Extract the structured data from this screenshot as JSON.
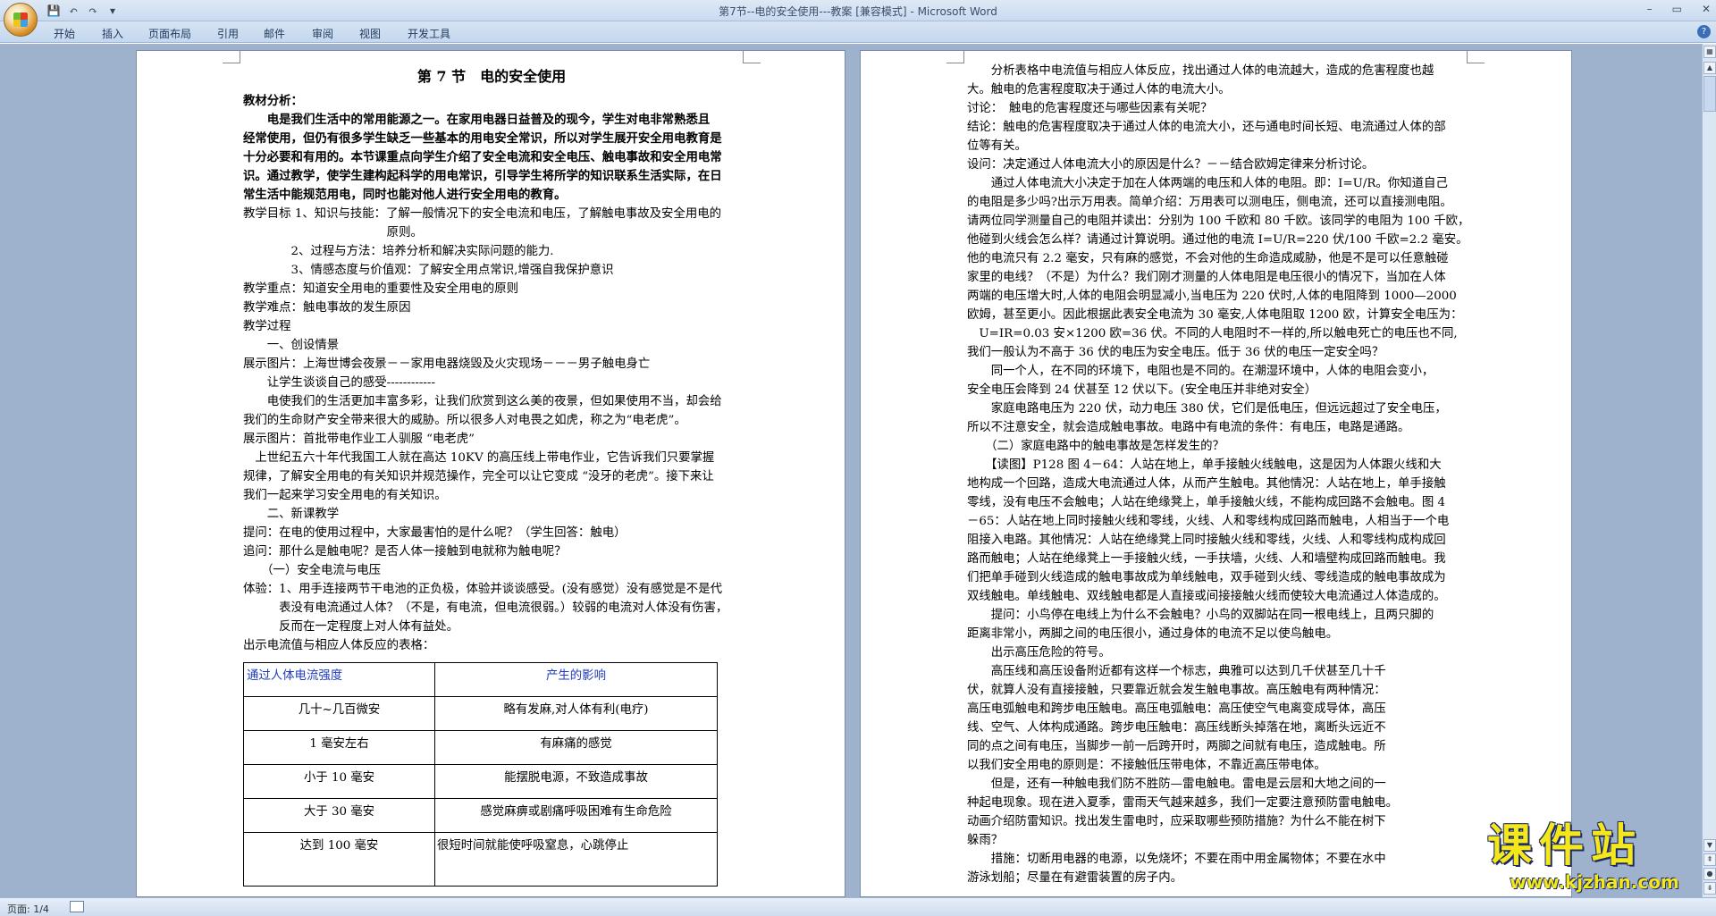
{
  "window": {
    "title": "第7节--电的安全使用---教案 [兼容模式] - Microsoft Word",
    "controls": [
      "–",
      "▭",
      "✕"
    ]
  },
  "ribbon": {
    "tabs": [
      "开始",
      "插入",
      "页面布局",
      "引用",
      "邮件",
      "审阅",
      "视图",
      "开发工具"
    ]
  },
  "status": {
    "page": "页面: 1/4"
  },
  "watermark": {
    "brand": "课件站",
    "url": "www.kjzhan.com"
  },
  "page1": {
    "lines": [
      "第 7 节　电的安全使用",
      "教材分析：",
      "　　电是我们生活中的常用能源之一。在家用电器日益普及的现今，学生对电非常熟悉且",
      "经常使用，但仍有很多学生缺乏一些基本的用电安全常识，所以对学生展开安全用电教育是",
      "十分必要和有用的。本节课重点向学生介绍了安全电流和安全电压、触电事故和安全用电常",
      "识。通过教学，使学生建构起科学的用电常识，引导学生将所学的知识联系生活实际，在日",
      "常生活中能规范用电，同时也能对他人进行安全用电的教育。",
      "教学目标 1、知识与技能：了解一般情况下的安全电流和电压，了解触电事故及安全用电的",
      "　　　　　　　　　　　　原则。",
      "　　　　2、过程与方法：培养分析和解决实际问题的能力.",
      "　　　　3、情感态度与价值观：了解安全用点常识,增强自我保护意识",
      "教学重点：知道安全用电的重要性及安全用电的原则",
      "教学难点：触电事故的发生原因",
      "教学过程",
      "　　一、创设情景",
      "展示图片：上海世博会夜景－－家用电器烧毁及火灾现场－－－男子触电身亡",
      "　　让学生谈谈自己的感受------------",
      "　　电使我们的生活更加丰富多彩，让我们欣赏到这么美的夜景，但如果使用不当，却会给",
      "我们的生命财产安全带来很大的威胁。所以很多人对电畏之如虎，称之为“电老虎”。",
      "展示图片：首批带电作业工人驯服 “电老虎”",
      "　上世纪五六十年代我国工人就在高达 10KV 的高压线上带电作业，它告诉我们只要掌握",
      "规律，了解安全用电的有关知识并规范操作，完全可以让它变成 “没牙的老虎”。接下来让",
      "我们一起来学习安全用电的有关知识。",
      "　　二、新课教学",
      "提问：在电的使用过程中，大家最害怕的是什么呢？（学生回答：触电）",
      "追问：那什么是触电呢？是否人体一接触到电就称为触电呢？",
      "　　（一）安全电流与电压",
      "体验：1、用手连接两节干电池的正负极，体验并谈谈感受。(没有感觉）没有感觉是不是代",
      "　　　表没有电流通过人体？（不是，有电流，但电流很弱。）较弱的电流对人体没有伤害，",
      "　　　反而在一定程度上对人体有益处。",
      "出示电流值与相应人体反应的表格："
    ],
    "table": {
      "headers": [
        "通过人体电流强度",
        "产生的影响"
      ],
      "rows": [
        [
          "几十~几百微安",
          "略有发麻,对人体有利(电疗)"
        ],
        [
          "1 毫安左右",
          "有麻痛的感觉"
        ],
        [
          "小于 10 毫安",
          "能摆脱电源，不致造成事故"
        ],
        [
          "大于 30 毫安",
          "感觉麻痹或剧痛呼吸困难有生命危险"
        ],
        [
          "达到 100 毫安",
          "很短时间就能使呼吸窒息，心跳停止"
        ]
      ]
    }
  },
  "page2": {
    "lines": [
      "　　分析表格中电流值与相应人体反应，找出通过人体的电流越大，造成的危害程度也越",
      "大。触电的危害程度取决于通过人体的电流大小。",
      "讨论：　触电的危害程度还与哪些因素有关呢？",
      "结论：触电的危害程度取决于通过人体的电流大小，还与通电时间长短、电流通过人体的部",
      "位等有关。",
      "设问：决定通过人体电流大小的原因是什么？－－结合欧姆定律来分析讨论。",
      "　　通过人体电流大小决定于加在人体两端的电压和人体的电阻。即：I=U/R。你知道自己",
      "的电阻是多少吗?出示万用表。简单介绍：万用表可以测电压，侧电流，还可以直接测电阻。",
      "请两位同学测量自己的电阻并读出：分别为 100 千欧和 80 千欧。该同学的电阻为 100 千欧，",
      "他碰到火线会怎么样？请通过计算说明。通过他的电流 I=U/R=220 伏/100 千欧=2.2 毫安。",
      "他的电流只有 2.2 毫安，只有麻的感觉，不会对他的生命造成威胁，他是不是可以任意触碰",
      "家里的电线？（不是）为什么？我们刚才测量的人体电阻是电压很小的情况下，当加在人体",
      "两端的电压增大时,人体的电阻会明显减小,当电压为 220 伏时,人体的电阻降到 1000—2000",
      "欧姆，甚至更小。因此根据此表安全电流为 30 毫安,人体电阻取 1200 欧，计算安全电压为：",
      "　U=IR=0.03 安×1200 欧=36 伏。不同的人电阻时不一样的,所以触电死亡的电压也不同,",
      "我们一般认为不高于 36 伏的电压为安全电压。低于 36 伏的电压一定安全吗？",
      "　　同一个人，在不同的环境下，电阻也是不同的。在潮湿环境中，人体的电阻会变小，",
      "安全电压会降到 24 伏甚至 12 伏以下。(安全电压并非绝对安全）",
      "　　家庭电路电压为 220 伏，动力电压 380 伏，它们是低电压，但远远超过了安全电压，",
      "所以不注意安全，就会造成触电事故。电路中有电流的条件：有电压，电路是通路。",
      "　　（二）家庭电路中的触电事故是怎样发生的？",
      "　　【读图】P128 图 4－64：人站在地上，单手接触火线触电，这是因为人体跟火线和大",
      "地构成一个回路，造成大电流通过人体，从而产生触电。其他情况：人站在地上，单手接触",
      "零线，没有电压不会触电；人站在绝缘凳上，单手接触火线，不能构成回路不会触电。图 4",
      "－65：人站在地上同时接触火线和零线，火线、人和零线构成回路而触电，人相当于一个电",
      "阻接入电路。其他情况：人站在绝缘凳上同时接触火线和零线，火线、人和零线构成构成回",
      "路而触电；人站在绝缘凳上一手接触火线，一手扶墙，火线、人和墙壁构成回路而触电。我",
      "们把单手碰到火线造成的触电事故成为单线触电，双手碰到火线、零线造成的触电事故成为",
      "双线触电。单线触电、双线触电都是人直接或间接接触火线而使较大电流通过人体造成的。",
      "　　提问：小鸟停在电线上为什么不会触电？小鸟的双脚站在同一根电线上，且两只脚的",
      "距离非常小，两脚之间的电压很小，通过身体的电流不足以使鸟触电。",
      "　　出示高压危险的符号。",
      "　　高压线和高压设备附近都有这样一个标志，典雅可以达到几千伏甚至几十千",
      "伏，就算人没有直接接触，只要靠近就会发生触电事故。高压触电有两种情况：",
      "高压电弧触电和跨步电压触电。高压电弧触电：高压使空气电离变成导体，高压",
      "线、空气、人体构成通路。跨步电压触电：高压线断头掉落在地，离断头远近不",
      "同的点之间有电压，当脚步一前一后跨开时，两脚之间就有电压，造成触电。所",
      "以我们安全用电的原则是：不接触低压带电体，不靠近高压带电体。",
      "　　但是，还有一种触电我们防不胜防—雷电触电。雷电是云层和大地之间的一",
      "种起电现象。现在进入夏季，雷雨天气越来越多，我们一定要注意预防雷电触电。",
      "动画介绍防雷知识。找出发生雷电时，应采取哪些预防措施？为什么不能在树下",
      "躲雨？",
      "　　措施：切断用电器的电源，以免烧坏；不要在雨中用金属物体；不要在水中",
      "游泳划船；尽量在有避雷装置的房子内。"
    ]
  }
}
